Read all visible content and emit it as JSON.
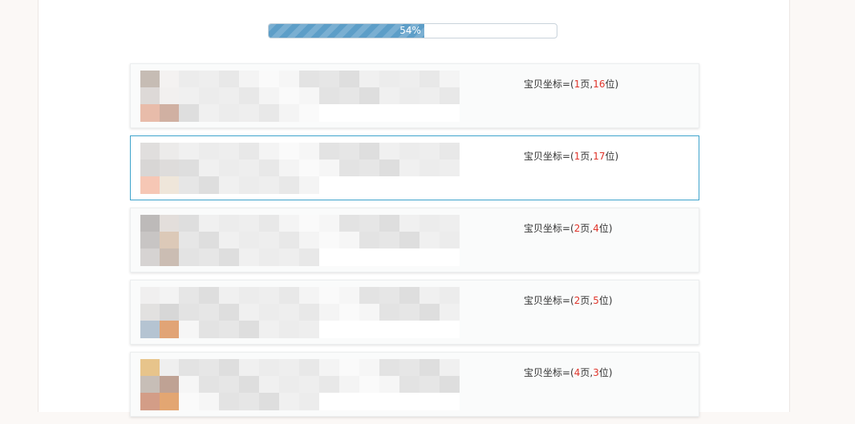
{
  "progress": {
    "percent": 0.54,
    "label": "54%"
  },
  "results": [
    {
      "prefix": "宝贝坐标=(",
      "page": "1",
      "mid": "页,",
      "pos": "16",
      "suffix": "位)",
      "selected": false,
      "thumb_colors": [
        "#c6bcb4",
        "#f4f2f1",
        "#ddd9d7",
        "#f2f0ef",
        "#e8bcaa",
        "#d0b0a2"
      ]
    },
    {
      "prefix": "宝贝坐标=(",
      "page": "1",
      "mid": "页,",
      "pos": "17",
      "suffix": "位)",
      "selected": true,
      "thumb_colors": [
        "#e0dedd",
        "#ecebea",
        "#d8d6d5",
        "#dedcdb",
        "#f6c7b5",
        "#efe6da"
      ]
    },
    {
      "prefix": "宝贝坐标=(",
      "page": "2",
      "mid": "页,",
      "pos": "4",
      "suffix": "位)",
      "selected": false,
      "thumb_colors": [
        "#bdbab9",
        "#e3dedb",
        "#c8c5c4",
        "#dcc9b8",
        "#d6d3d2",
        "#cbbdb3"
      ]
    },
    {
      "prefix": "宝贝坐标=(",
      "page": "2",
      "mid": "页,",
      "pos": "5",
      "suffix": "位)",
      "selected": false,
      "thumb_colors": [
        "#f0efef",
        "#f3f3f3",
        "#e2e1e0",
        "#d7d7d7",
        "#b5c4d2",
        "#e1a476"
      ]
    },
    {
      "prefix": "宝贝坐标=(",
      "page": "4",
      "mid": "页,",
      "pos": "3",
      "suffix": "位)",
      "selected": false,
      "thumb_colors": [
        "#e7c48b",
        "#efefef",
        "#c7beb7",
        "#bfa294",
        "#d39d87",
        "#e3a672"
      ]
    }
  ]
}
